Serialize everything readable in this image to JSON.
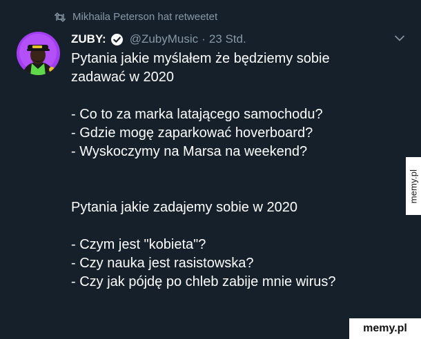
{
  "retweet": {
    "icon": "retweet-icon",
    "text": "Mikhaila Peterson hat retweetet"
  },
  "tweet": {
    "avatar": "avatar-icon",
    "author_name": "ZUBY:",
    "verified_icon": "verified-badge-icon",
    "handle": "@ZubyMusic",
    "separator": "·",
    "time": "23 Std.",
    "menu_icon": "chevron-down-icon",
    "lines": [
      "Pytania jakie myślałem że będziemy sobie",
      "zadawać w 2020",
      "- Co to za marka latającego samochodu?",
      "- Gdzie mogę zaparkować hoverboard?",
      "- Wyskoczymy na Marsa na weekend?",
      "Pytania jakie zadajemy sobie w 2020",
      "- Czym jest \"kobieta\"?",
      "- Czy nauka jest rasistowska?",
      "- Czy jak pójdę po chleb zabije mnie wirus?"
    ]
  },
  "watermarks": {
    "side": "memy.pl",
    "corner": "memy.pl"
  },
  "colors": {
    "background": "#15202b",
    "text_primary": "#ffffff",
    "text_secondary": "#8899a6",
    "verified_badge": "#ffffff"
  }
}
